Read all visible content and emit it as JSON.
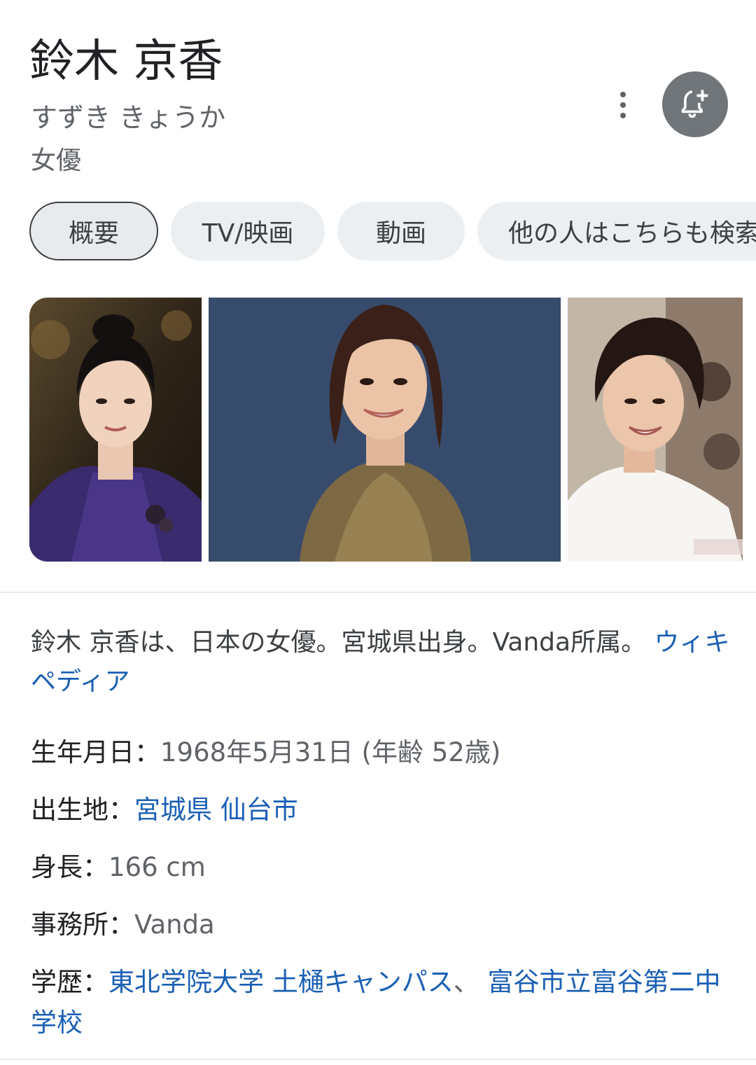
{
  "header": {
    "title": "鈴木 京香",
    "reading": "すずき きょうか",
    "subtitle": "女優"
  },
  "chips": [
    {
      "label": "概要"
    },
    {
      "label": "TV/映画"
    },
    {
      "label": "動画"
    },
    {
      "label": "他の人はこちらも検索"
    }
  ],
  "description": {
    "text": "鈴木 京香は、日本の女優。宮城県出身。Vanda所属。",
    "source_link": "ウィキペディア"
  },
  "facts": {
    "birth": {
      "label": "生年月日：",
      "value": "1968年5月31日 (年齢 52歳)"
    },
    "birthplace": {
      "label": "出生地：",
      "value_1": "宮城県",
      "value_2": "仙台市"
    },
    "height": {
      "label": "身長：",
      "value": "166 cm"
    },
    "agency": {
      "label": "事務所：",
      "value": "Vanda"
    },
    "education": {
      "label": "学歴：",
      "value_1": "東北学院大学 土樋キャンパス",
      "separator": "、",
      "value_2": "富谷市立富谷第二中学校"
    }
  },
  "icons": {
    "more": "more-vert-icon",
    "follow": "bell-add-icon"
  },
  "colors": {
    "link": "#1a5fb4",
    "chip_bg": "#eceff1",
    "follow_bg": "#70757a"
  }
}
